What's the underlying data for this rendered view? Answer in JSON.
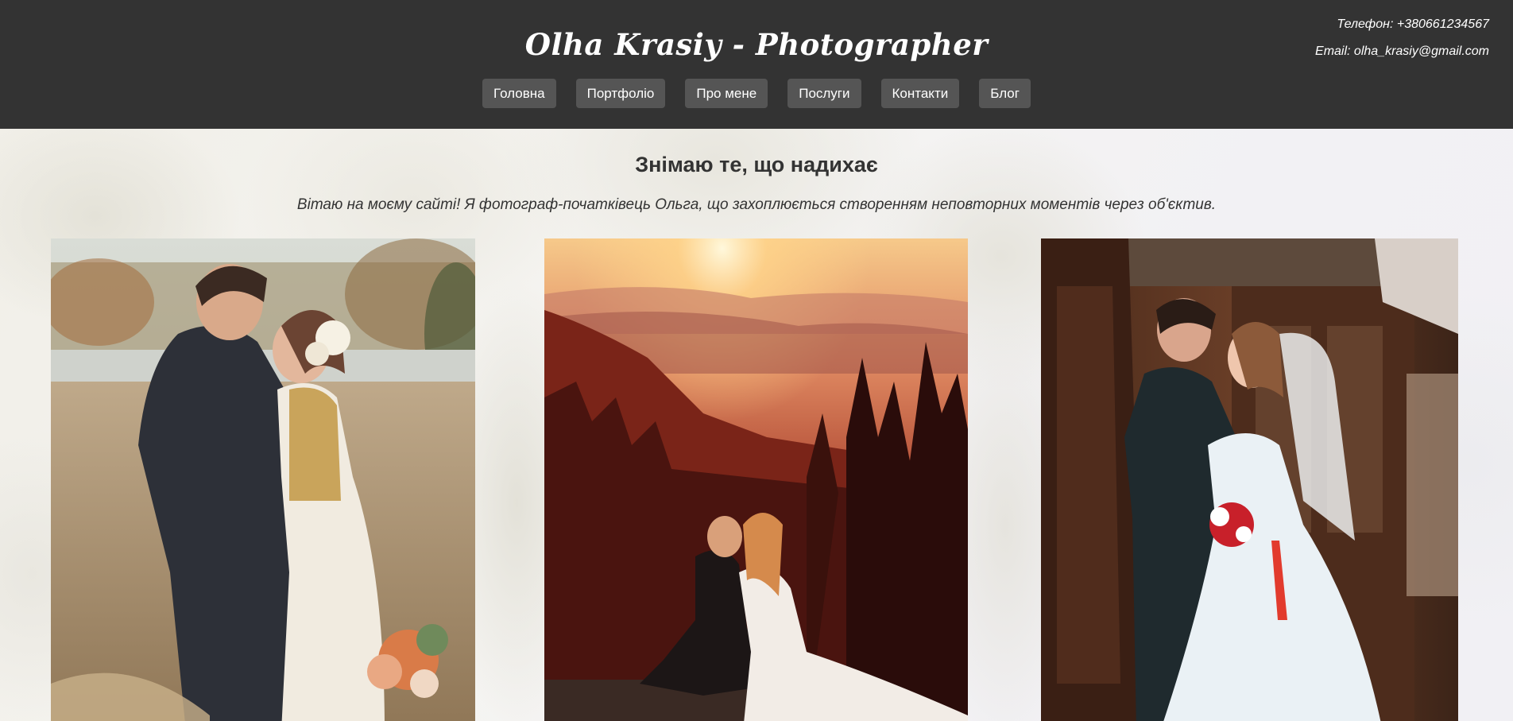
{
  "header": {
    "title": "Olha Krasiy - Photographer",
    "phone": "Телефон: +380661234567",
    "email": "Email: olha_krasiy@gmail.com"
  },
  "nav": {
    "items": [
      {
        "label": "Головна"
      },
      {
        "label": "Портфоліо"
      },
      {
        "label": "Про мене"
      },
      {
        "label": "Послуги"
      },
      {
        "label": "Контакти"
      },
      {
        "label": "Блог"
      }
    ]
  },
  "main": {
    "heading": "Знімаю те, що надихає",
    "intro": "Вітаю на моєму сайті! Я фотограф-початківець Ольга, що захоплюється створенням неповторних моментів через об'єктив."
  },
  "colors": {
    "header_bg": "#333333",
    "nav_button_bg": "#555555",
    "text_dark": "#333333"
  }
}
